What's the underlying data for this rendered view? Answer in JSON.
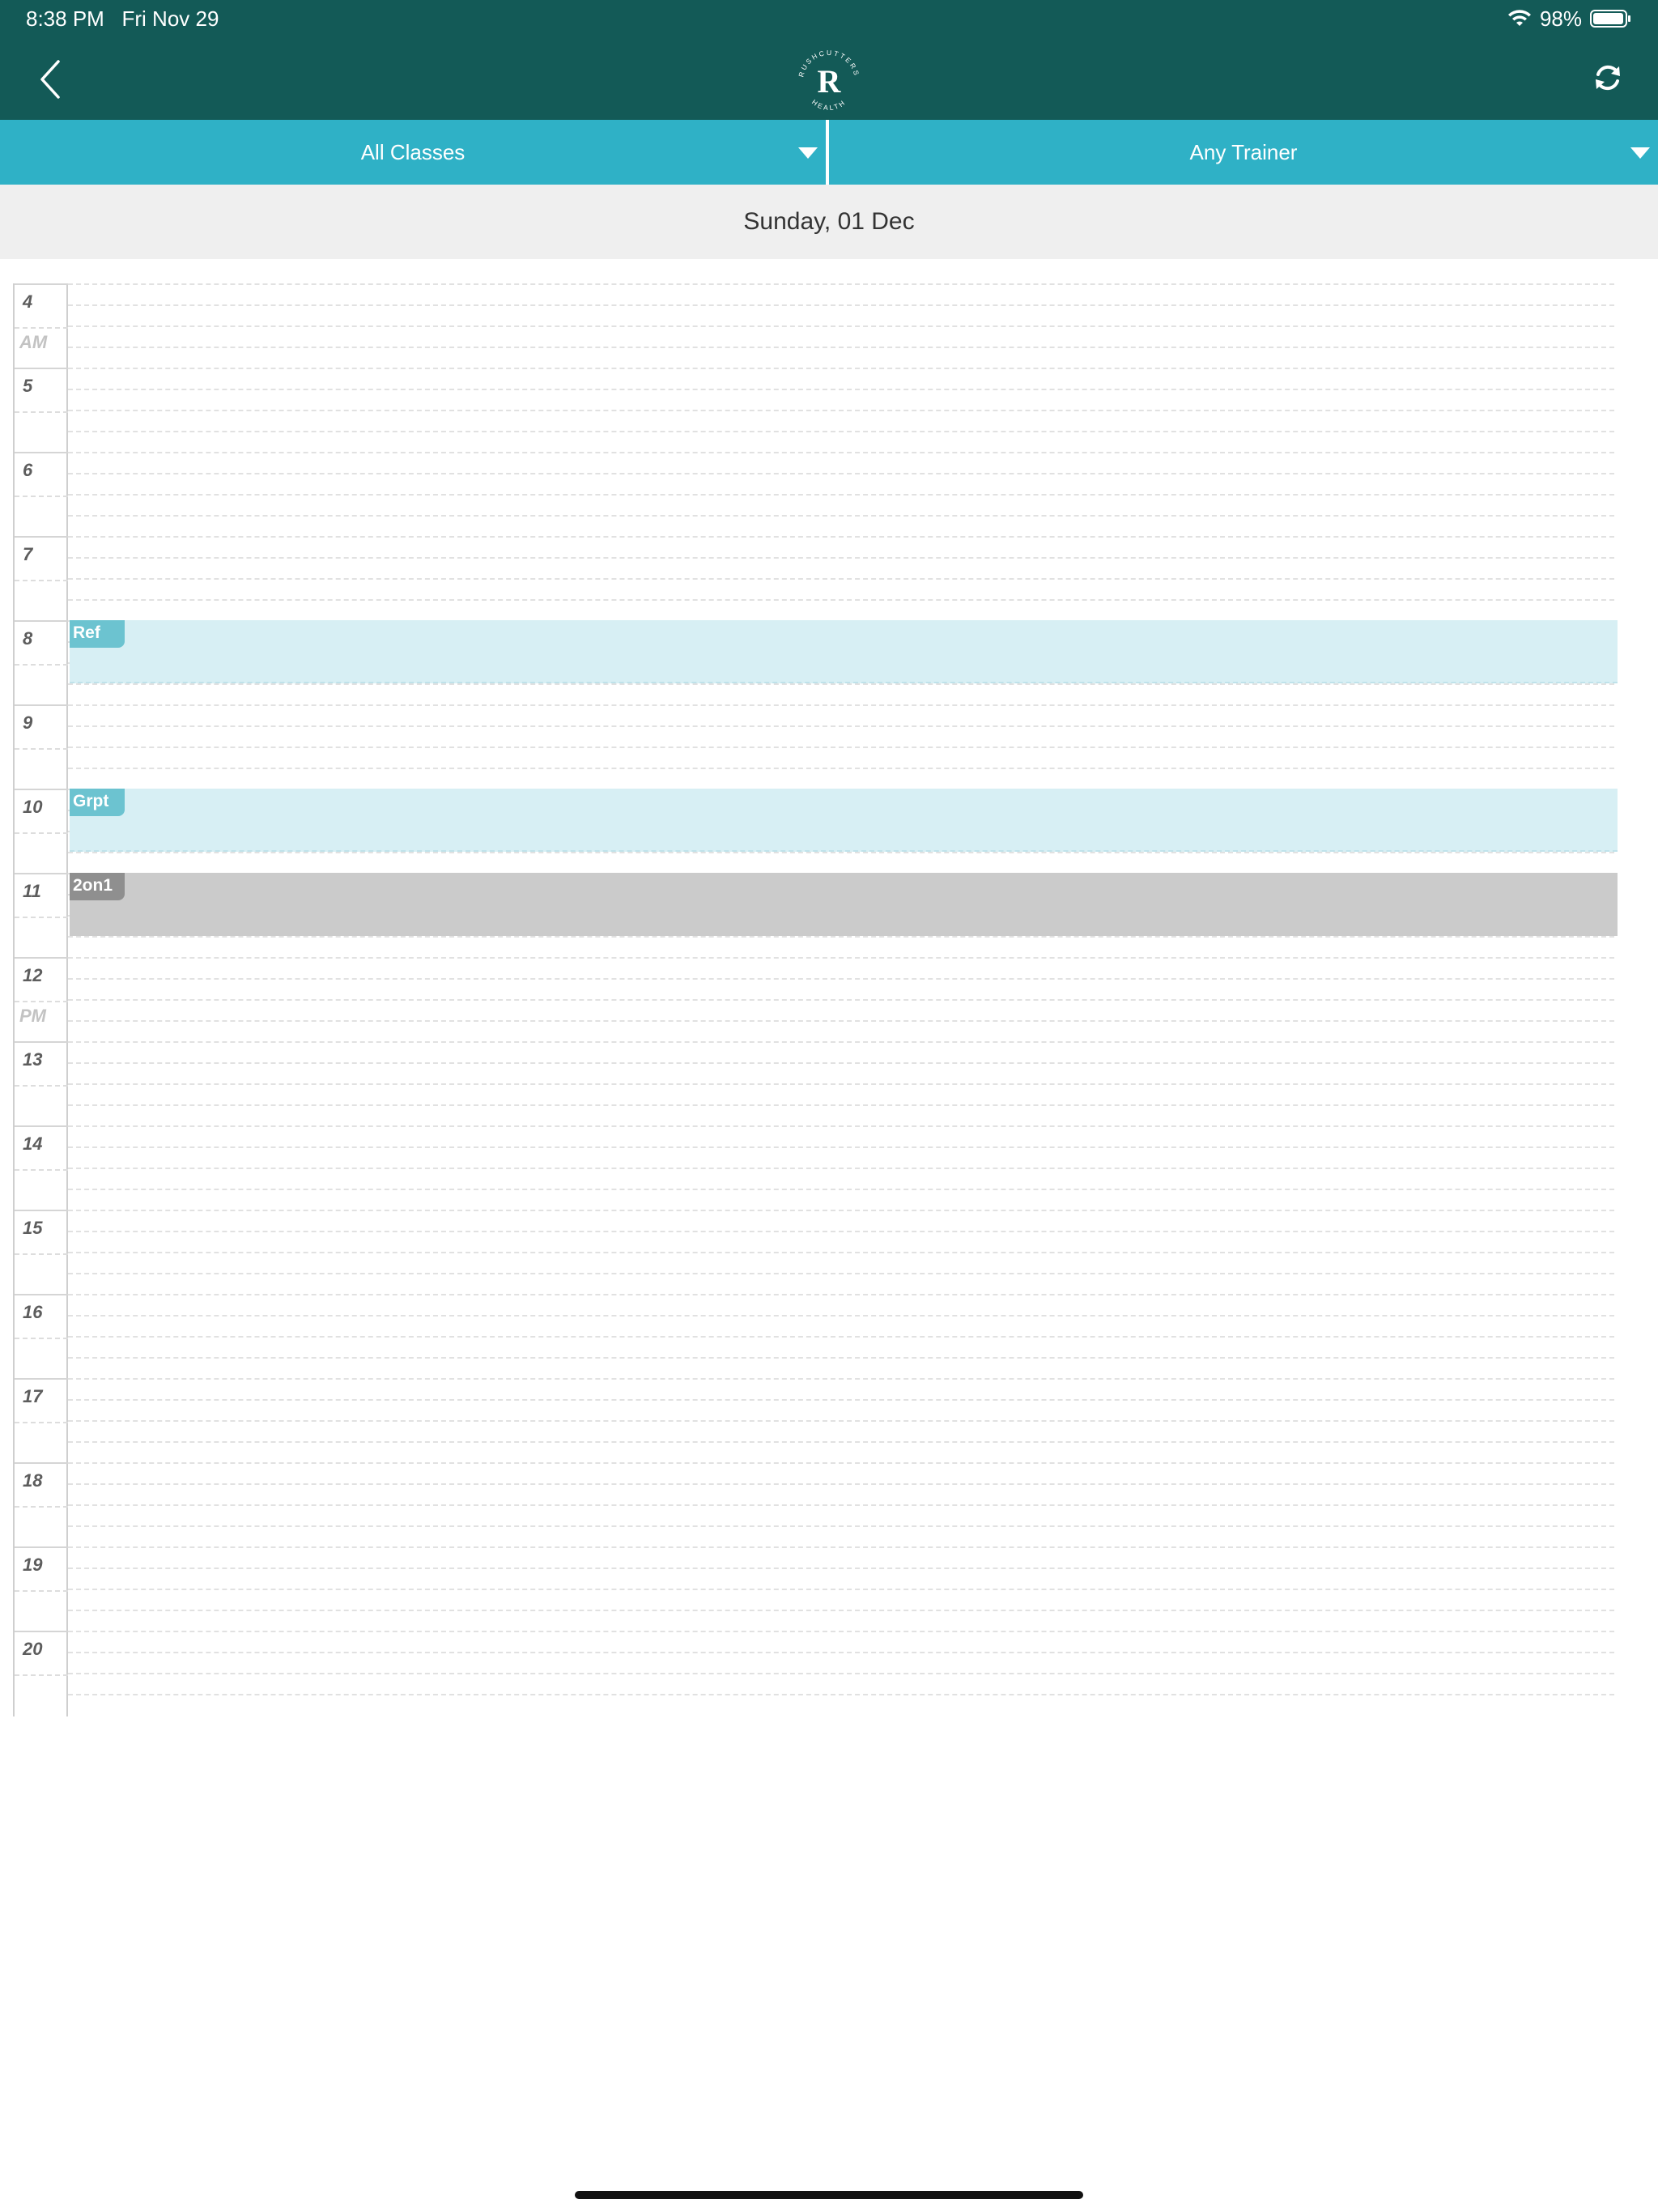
{
  "status_bar": {
    "time": "8:38 PM",
    "date": "Fri Nov 29",
    "battery": "98%",
    "wifi_icon": "wifi-icon",
    "battery_icon": "battery-icon"
  },
  "nav": {
    "back_icon": "chevron-left-icon",
    "logo_letter": "R",
    "logo_text_top": "RUSHCUTTERS",
    "logo_text_bottom": "HEALTH",
    "refresh_icon": "refresh-icon"
  },
  "filters": {
    "classes": "All Classes",
    "trainer": "Any Trainer"
  },
  "date_header": "Sunday, 01 Dec",
  "hours": [
    {
      "label": "4",
      "ampm": "AM"
    },
    {
      "label": "5",
      "ampm": ""
    },
    {
      "label": "6",
      "ampm": ""
    },
    {
      "label": "7",
      "ampm": ""
    },
    {
      "label": "8",
      "ampm": ""
    },
    {
      "label": "9",
      "ampm": ""
    },
    {
      "label": "10",
      "ampm": ""
    },
    {
      "label": "11",
      "ampm": ""
    },
    {
      "label": "12",
      "ampm": "PM"
    },
    {
      "label": "13",
      "ampm": ""
    },
    {
      "label": "14",
      "ampm": ""
    },
    {
      "label": "15",
      "ampm": ""
    },
    {
      "label": "16",
      "ampm": ""
    },
    {
      "label": "17",
      "ampm": ""
    },
    {
      "label": "18",
      "ampm": ""
    },
    {
      "label": "19",
      "ampm": ""
    },
    {
      "label": "20",
      "ampm": ""
    }
  ],
  "events": [
    {
      "label": "Ref",
      "hour": 8,
      "color": "#6cc3d0"
    },
    {
      "label": "Grpt",
      "hour": 10,
      "color": "#6cc3d0"
    },
    {
      "label": "2on1",
      "hour": 11,
      "color": "#8f8f8f"
    }
  ],
  "colors": {
    "header": "#135a57",
    "filter_bar": "#2fb1c6",
    "date_bar": "#efefef",
    "event_teal": "#d7eff4",
    "event_gray": "#cbcbcb"
  }
}
